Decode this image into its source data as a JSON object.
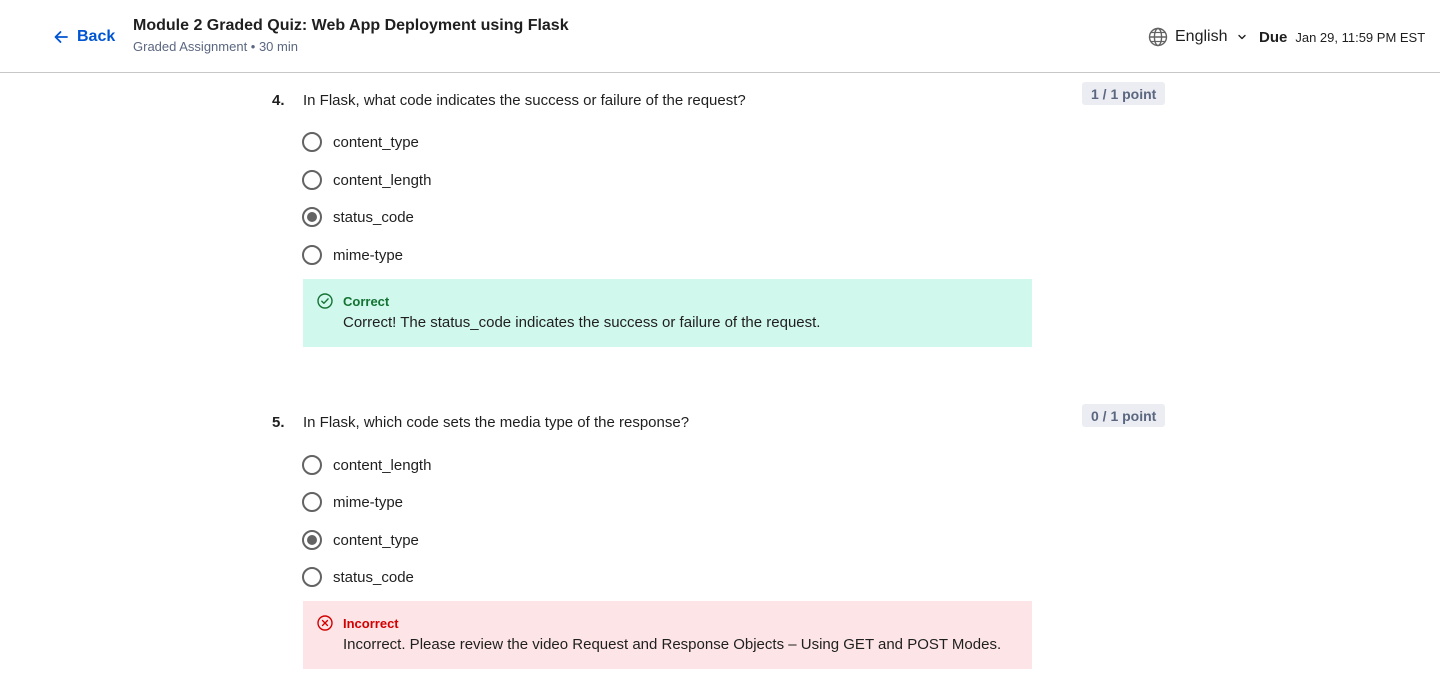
{
  "header": {
    "back_label": "Back",
    "title": "Module 2 Graded Quiz: Web App Deployment using Flask",
    "subtitle": "Graded Assignment • 30 min",
    "language": "English",
    "due_label": "Due",
    "due_date": "Jan 29, 11:59 PM EST"
  },
  "questions": [
    {
      "number": "4.",
      "text": "In Flask, what code indicates the success or failure of the request?",
      "points": "1 / 1 point",
      "options": [
        "content_type",
        "content_length",
        "status_code",
        "mime-type"
      ],
      "selected": "status_code",
      "feedback": {
        "status": "Correct",
        "text": "Correct! The status_code indicates the success or failure of the request."
      }
    },
    {
      "number": "5.",
      "text": "In Flask, which code sets the media type of the response?",
      "points": "0 / 1 point",
      "options": [
        "content_length",
        "mime-type",
        "content_type",
        "status_code"
      ],
      "selected": "content_type",
      "feedback": {
        "status": "Incorrect",
        "text": "Incorrect. Please review the video Request and Response Objects – Using GET and POST Modes."
      }
    }
  ],
  "colors": {
    "accent": "#0056d2",
    "correct_bg": "#d1f8ec",
    "correct_text": "#137333",
    "incorrect_bg": "#fde5e7",
    "incorrect_text": "#d30001"
  },
  "icons": {
    "back": "arrow-left-icon",
    "language": "globe-icon",
    "language_menu": "chevron-down-icon",
    "correct": "check-circle-icon",
    "incorrect": "x-circle-icon"
  }
}
